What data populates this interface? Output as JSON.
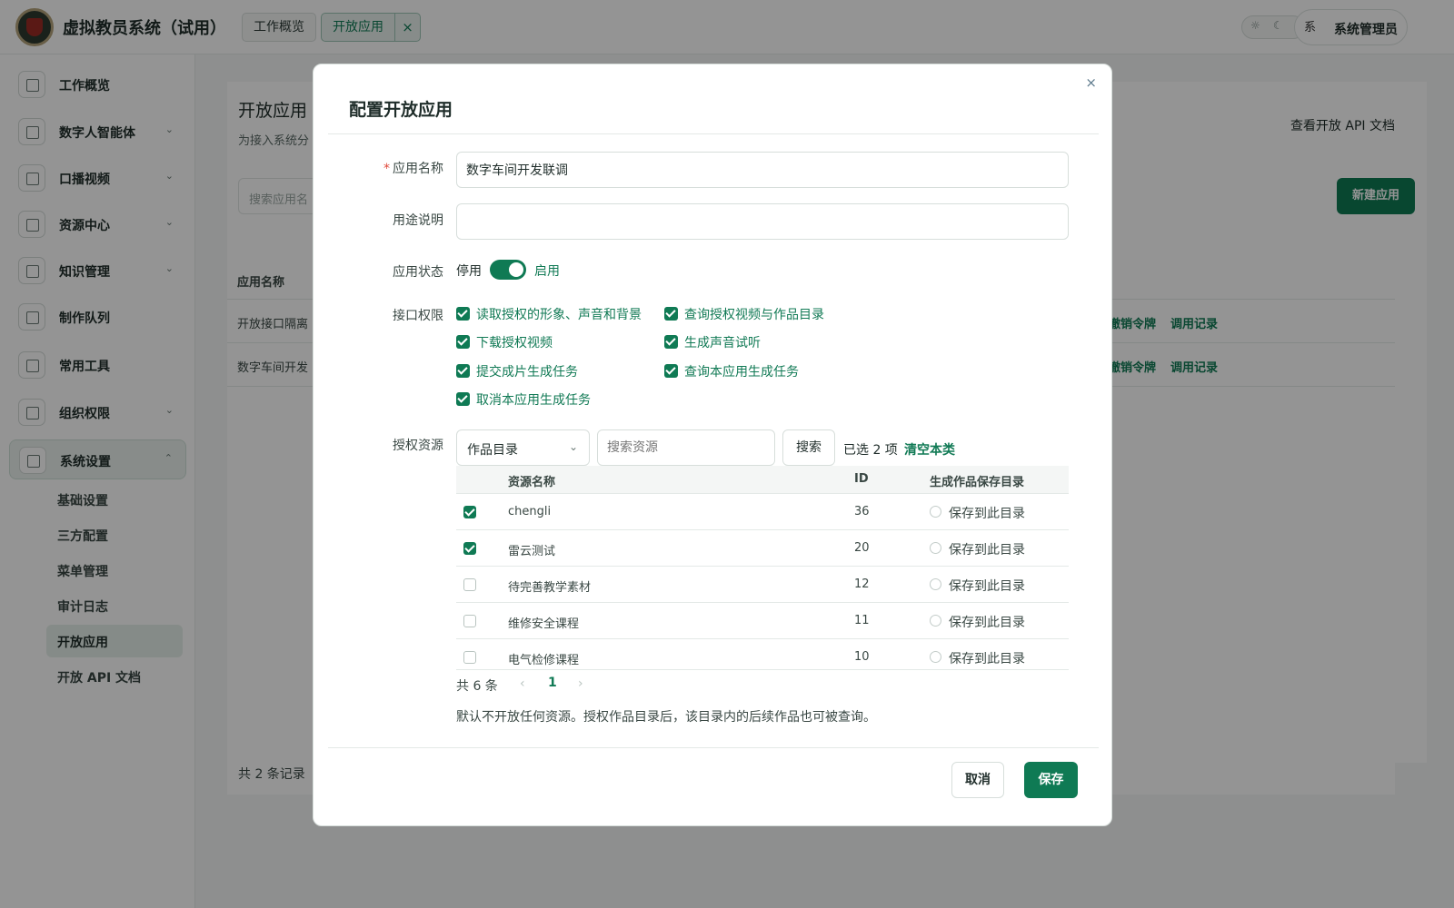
{
  "app": {
    "title": "虚拟教员系统（试用）"
  },
  "tabs": [
    {
      "label": "工作概览"
    },
    {
      "label": "开放应用",
      "close": "×"
    }
  ],
  "user": {
    "avatar": "系",
    "name": "系统管理员"
  },
  "theme_toggle": {
    "light": "☼",
    "dark": "☾"
  },
  "sidebar": {
    "items": [
      {
        "label": "工作概览",
        "icon": "monitor-icon"
      },
      {
        "label": "数字人智能体",
        "icon": "desktop-icon",
        "expand": "⌄"
      },
      {
        "label": "口播视频",
        "icon": "grid-icon",
        "expand": "⌄"
      },
      {
        "label": "资源中心",
        "icon": "save-icon",
        "expand": "⌄"
      },
      {
        "label": "知识管理",
        "icon": "lock-icon",
        "expand": "⌄"
      },
      {
        "label": "制作队列",
        "icon": "clipboard-icon"
      },
      {
        "label": "常用工具",
        "icon": "apps-icon"
      },
      {
        "label": "组织权限",
        "icon": "building-icon",
        "expand": "⌄"
      },
      {
        "label": "系统设置",
        "icon": "gear-icon",
        "expand": "⌃"
      }
    ],
    "sub_items": [
      {
        "label": "基础设置"
      },
      {
        "label": "三方配置"
      },
      {
        "label": "菜单管理"
      },
      {
        "label": "审计日志"
      },
      {
        "label": "开放应用"
      },
      {
        "label": "开放 API 文档"
      }
    ]
  },
  "page": {
    "title": "开放应用",
    "subtitle": "为接入系统分",
    "doc_link": "查看开放 API 文档",
    "search_placeholder": "搜索应用名",
    "new_button": "新建应用",
    "col_name": "应用名称",
    "rows": [
      {
        "name": "开放接口隔离",
        "revoke": "撤销令牌",
        "log": "调用记录"
      },
      {
        "name": "数字车间开发",
        "revoke": "撤销令牌",
        "log": "调用记录"
      }
    ],
    "footer": "共 2 条记录"
  },
  "modal": {
    "title": "配置开放应用",
    "close": "×",
    "fields": {
      "name_label": "应用名称",
      "name_required": "*",
      "name_value": "数字车间开发联调",
      "desc_label": "用途说明",
      "desc_value": "",
      "status_label": "应用状态",
      "status_off": "停用",
      "status_on": "启用",
      "perms_label": "接口权限",
      "perms": [
        {
          "label": "读取授权的形象、声音和背景",
          "checked": true
        },
        {
          "label": "查询授权视频与作品目录",
          "checked": true
        },
        {
          "label": "下载授权视频",
          "checked": true
        },
        {
          "label": "生成声音试听",
          "checked": true
        },
        {
          "label": "提交成片生成任务",
          "checked": true
        },
        {
          "label": "查询本应用生成任务",
          "checked": true
        },
        {
          "label": "取消本应用生成任务",
          "checked": true
        }
      ],
      "res_label": "授权资源",
      "res_type": "作品目录",
      "res_search_placeholder": "搜索资源",
      "search_button": "搜索",
      "selected": "已选 2 项",
      "clear": "清空本类"
    },
    "table": {
      "headers": {
        "name": "资源名称",
        "id": "ID",
        "save_dir": "生成作品保存目录"
      },
      "rows": [
        {
          "name": "chengli",
          "id": "36",
          "checked": true,
          "save": "保存到此目录"
        },
        {
          "name": "雷云测试",
          "id": "20",
          "checked": true,
          "save": "保存到此目录"
        },
        {
          "name": "待完善教学素材",
          "id": "12",
          "checked": false,
          "save": "保存到此目录"
        },
        {
          "name": "维修安全课程",
          "id": "11",
          "checked": false,
          "save": "保存到此目录"
        },
        {
          "name": "电气检修课程",
          "id": "10",
          "checked": false,
          "save": "保存到此目录"
        }
      ]
    },
    "pager": {
      "total": "共 6 条",
      "prev": "‹",
      "current": "1",
      "next": "›"
    },
    "hint": "默认不开放任何资源。授权作品目录后，该目录内的后续作品也可被查询。",
    "cancel": "取消",
    "save": "保存"
  }
}
